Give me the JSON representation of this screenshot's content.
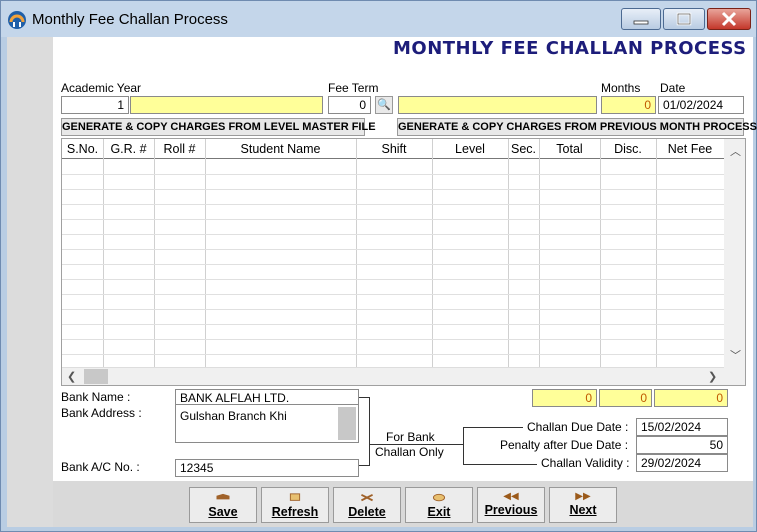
{
  "window": {
    "title": "Monthly Fee Challan Process",
    "min_icon": "minimize-icon",
    "max_icon": "maximize-icon",
    "close_icon": "close-icon",
    "close_glyph": "✕",
    "min_glyph": "▁",
    "max_glyph": "▢"
  },
  "form": {
    "heading": "MONTHLY FEE CHALLAN PROCESS"
  },
  "fields": {
    "academic_year_label": "Academic Year",
    "academic_year_value": "1",
    "academic_year_desc": "",
    "fee_term_label": "Fee Term",
    "fee_term_value": "0",
    "fee_term_desc": "",
    "months_label": "Months",
    "months_value": "0",
    "date_label": "Date",
    "date_value": "01/02/2024"
  },
  "actions": {
    "gen_level": "GENERATE & COPY CHARGES FROM LEVEL MASTER FILE",
    "gen_previous": "GENERATE & COPY CHARGES FROM PREVIOUS MONTH PROCESS",
    "lookup_glyph": "🔍"
  },
  "grid": {
    "columns": [
      "S.No.",
      "G.R. #",
      "Roll #",
      "Student Name",
      "Shift",
      "Level",
      "Sec.",
      "Total",
      "Disc.",
      "Net Fee"
    ],
    "rows": []
  },
  "totals": {
    "total": "0",
    "discount": "0",
    "net_fee": "0"
  },
  "bank": {
    "name_label": "Bank Name :",
    "name_value": "BANK ALFLAH LTD.",
    "address_label": "Bank Address :",
    "address_value": "Gulshan Branch Khi",
    "account_label": "Bank A/C No. :",
    "account_value": "12345",
    "note_line1": "For Bank",
    "note_line2": "Challan Only"
  },
  "challan": {
    "due_date_label": "Challan Due Date :",
    "due_date_value": "15/02/2024",
    "penalty_label": "Penalty after Due Date :",
    "penalty_value": "50",
    "validity_label": "Challan Validity :",
    "validity_value": "29/02/2024"
  },
  "toolbar": {
    "save": "Save",
    "refresh": "Refresh",
    "delete": "Delete",
    "exit": "Exit",
    "previous": "Previous",
    "next": "Next",
    "prev_glyph": "◀◀",
    "next_glyph": "▶▶"
  },
  "colors": {
    "heading": "#1d1d7a",
    "highlight": "#ffff99",
    "value_orange": "#c05a00"
  }
}
